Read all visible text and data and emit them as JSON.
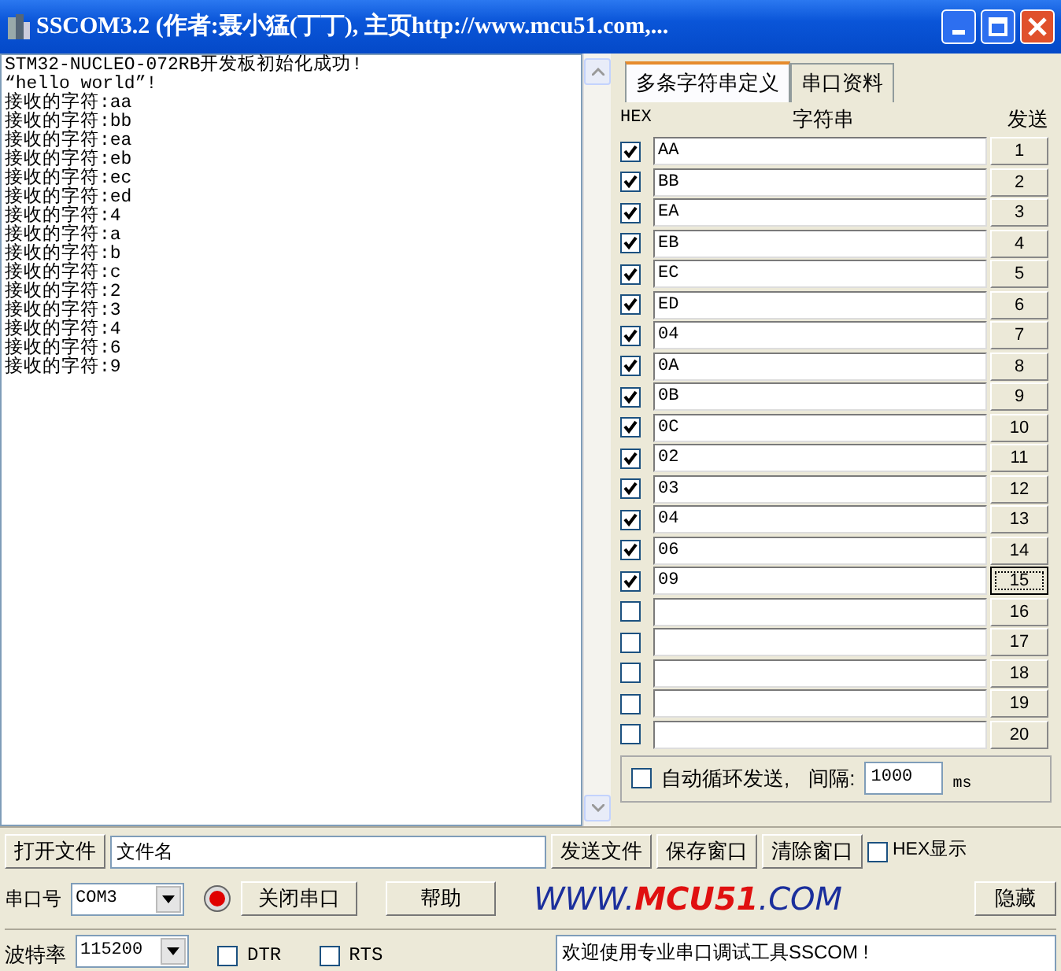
{
  "window": {
    "title": "SSCOM3.2 (作者:聂小猛(丁丁), 主页http://www.mcu51.com,..."
  },
  "receive_log": {
    "lines": [
      "STM32-NUCLEO-072RB开发板初始化成功!",
      "“hello world”!",
      "接收的字符:aa",
      "接收的字符:bb",
      "接收的字符:ea",
      "接收的字符:eb",
      "接收的字符:ec",
      "接收的字符:ed",
      "接收的字符:4",
      "接收的字符:a",
      "接收的字符:b",
      "接收的字符:c",
      "接收的字符:2",
      "接收的字符:3",
      "接收的字符:4",
      "接收的字符:6",
      "接收的字符:9"
    ]
  },
  "tabs": [
    {
      "label": "多条字符串定义",
      "selected": true
    },
    {
      "label": "串口资料",
      "selected": false
    }
  ],
  "string_table": {
    "columns": [
      "HEX",
      "字符串",
      "发送"
    ],
    "rows": [
      {
        "hex": true,
        "value": "AA",
        "send": "1",
        "focused": false
      },
      {
        "hex": true,
        "value": "BB",
        "send": "2",
        "focused": false
      },
      {
        "hex": true,
        "value": "EA",
        "send": "3",
        "focused": false
      },
      {
        "hex": true,
        "value": "EB",
        "send": "4",
        "focused": false
      },
      {
        "hex": true,
        "value": "EC",
        "send": "5",
        "focused": false
      },
      {
        "hex": true,
        "value": "ED",
        "send": "6",
        "focused": false
      },
      {
        "hex": true,
        "value": "04",
        "send": "7",
        "focused": false
      },
      {
        "hex": true,
        "value": "0A",
        "send": "8",
        "focused": false
      },
      {
        "hex": true,
        "value": "0B",
        "send": "9",
        "focused": false
      },
      {
        "hex": true,
        "value": "0C",
        "send": "10",
        "focused": false
      },
      {
        "hex": true,
        "value": "02",
        "send": "11",
        "focused": false
      },
      {
        "hex": true,
        "value": "03",
        "send": "12",
        "focused": false
      },
      {
        "hex": true,
        "value": "04",
        "send": "13",
        "focused": false
      },
      {
        "hex": true,
        "value": "06",
        "send": "14",
        "focused": false
      },
      {
        "hex": true,
        "value": "09",
        "send": "15",
        "focused": true
      },
      {
        "hex": false,
        "send": "16",
        "focused": false
      },
      {
        "hex": false,
        "send": "17",
        "focused": false
      },
      {
        "hex": false,
        "send": "18",
        "focused": false
      },
      {
        "hex": false,
        "send": "19",
        "focused": false
      },
      {
        "hex": false,
        "send": "20",
        "focused": false
      }
    ]
  },
  "auto_send": {
    "label": "自动循环发送,",
    "checked": false,
    "interval_label": "间隔:",
    "interval": "1000",
    "unit": "ms"
  },
  "file_bar": {
    "open_button": "打开文件",
    "filename": "文件名",
    "buttons": [
      "发送文件",
      "保存窗口",
      "清除窗口"
    ],
    "hex_display": {
      "label": "HEX显示",
      "checked": false
    }
  },
  "port_bar": {
    "port_label": "串口号",
    "port": "COM3",
    "port_open": true,
    "toggle_button": "关闭串口",
    "help_button": "帮助",
    "logo": [
      {
        "text": "WWW.",
        "kind": "plain"
      },
      {
        "text": "MCU51",
        "kind": "accent"
      },
      {
        "text": ".COM",
        "kind": "plain"
      }
    ],
    "hide_button": "隐藏"
  },
  "baud_bar": {
    "label": "波特率",
    "baud": "115200",
    "dtr": {
      "label": "DTR",
      "checked": false
    },
    "rts": {
      "label": "RTS",
      "checked": false
    },
    "message": "欢迎使用专业串口调试工具SSCOM !"
  }
}
